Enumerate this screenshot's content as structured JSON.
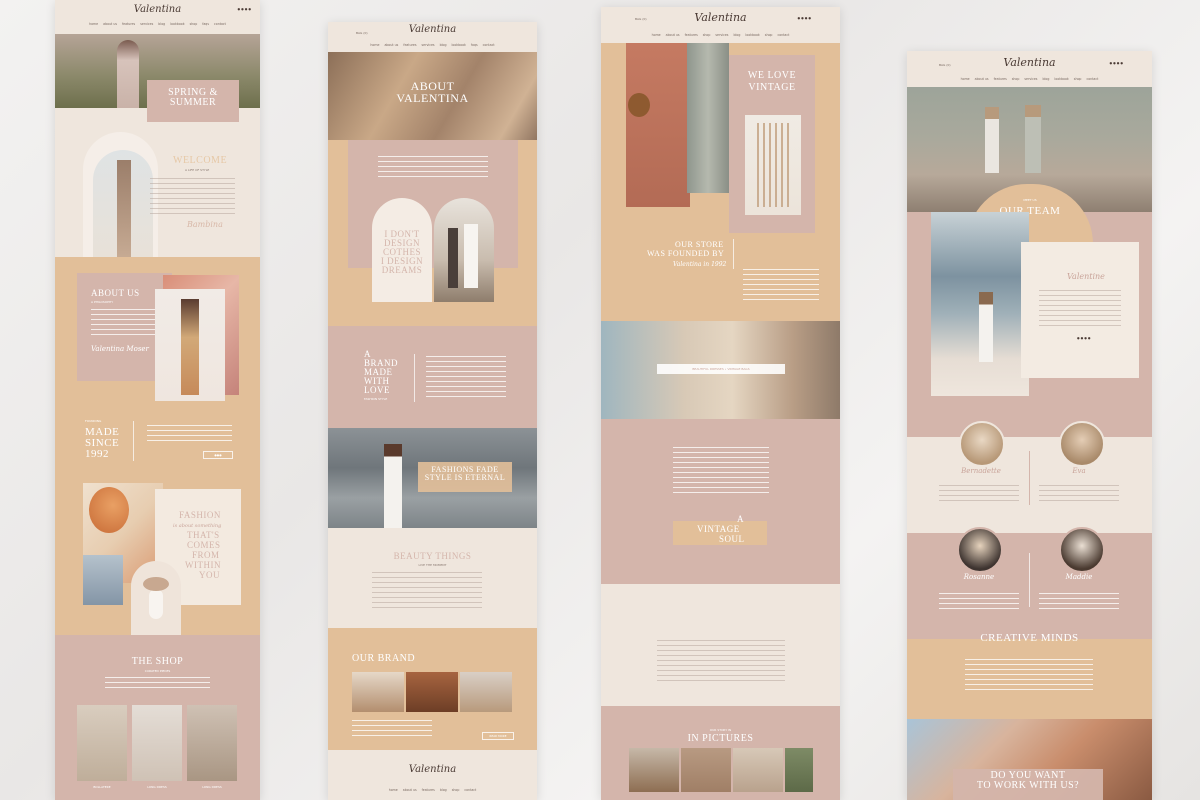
{
  "brand": "Valentina",
  "cart_label": "BAG (0)",
  "nav": [
    "home",
    "about us",
    "features",
    "shop",
    "services",
    "blog",
    "lookbook",
    "shop",
    "faqs",
    "contact"
  ],
  "socials": "●●●●",
  "page1": {
    "hero_title_1": "SPRING &",
    "hero_title_2": "SUMMER",
    "welcome": "WELCOME",
    "welcome_sub": "A LIFE OF STYLE",
    "signature": "Bambina",
    "about": "ABOUT US",
    "about_sub": "A PHILOSOPHY",
    "about_sig": "Valentina Moser",
    "founding": "FOUNDING",
    "made_since_1": "MADE",
    "made_since_2": "SINCE",
    "made_since_3": "1992",
    "fashion_1": "FASHION",
    "fashion_script": "is about something",
    "fashion_2": "THAT'S",
    "fashion_3": "COMES",
    "fashion_4": "FROM",
    "fashion_5": "WITHIN",
    "fashion_6": "YOU",
    "shop_title": "THE SHOP",
    "shop_sub": "CURATED PIECES",
    "products": [
      "BOLLATERE",
      "LONG DRESS",
      "LONG DRESS"
    ]
  },
  "page2": {
    "about_title_1": "ABOUT",
    "about_title_2": "VALENTINA",
    "quote_1": "I DON'T",
    "quote_2": "DESIGN",
    "quote_3": "COTHES",
    "quote_4": "I DESIGN",
    "quote_5": "DREAMS",
    "brand_made_1": "A",
    "brand_made_2": "BRAND",
    "brand_made_3": "MADE",
    "brand_made_4": "WITH",
    "brand_made_5": "LOVE",
    "brand_made_sub": "FASHION STYLE",
    "fashion_fade_1": "FASHIONS FADE",
    "fashion_fade_2": "STYLE IS ETERNAL",
    "beauty": "BEAUTY THINGS",
    "beauty_sub": "LIVE THE MOMENT",
    "our_brand": "OUR BRAND",
    "read_more": "READ MORE"
  },
  "page3": {
    "we_love_1": "WE LOVE",
    "we_love_2": "VINTAGE",
    "store_1": "OUR STORE",
    "store_2": "WAS FOUNDED BY",
    "store_script": "Valentina in 1992",
    "banner": "BEAUTIFUL DRESSES • VINTAGE BAGS",
    "vintage_1": "A",
    "vintage_2": "VINTAGE",
    "vintage_3": "SOUL",
    "pictures_1": "OUR STORY IN",
    "pictures_2": "IN PICTURES"
  },
  "page4": {
    "team_label": "MEET US",
    "team": "OUR TEAM",
    "owner_script": "Valentine",
    "members": [
      "Bernadette",
      "Eva",
      "Rosanne",
      "Maddie"
    ],
    "creative": "CREATIVE MINDS",
    "work_1": "DO YOU WANT",
    "work_2": "TO WORK WITH US?"
  },
  "colors": {
    "cream": "#efe6dd",
    "mauve": "#d4b5ab",
    "sand": "#e2bf99",
    "rose": "#c9a49a",
    "ink": "#4a3a34"
  }
}
